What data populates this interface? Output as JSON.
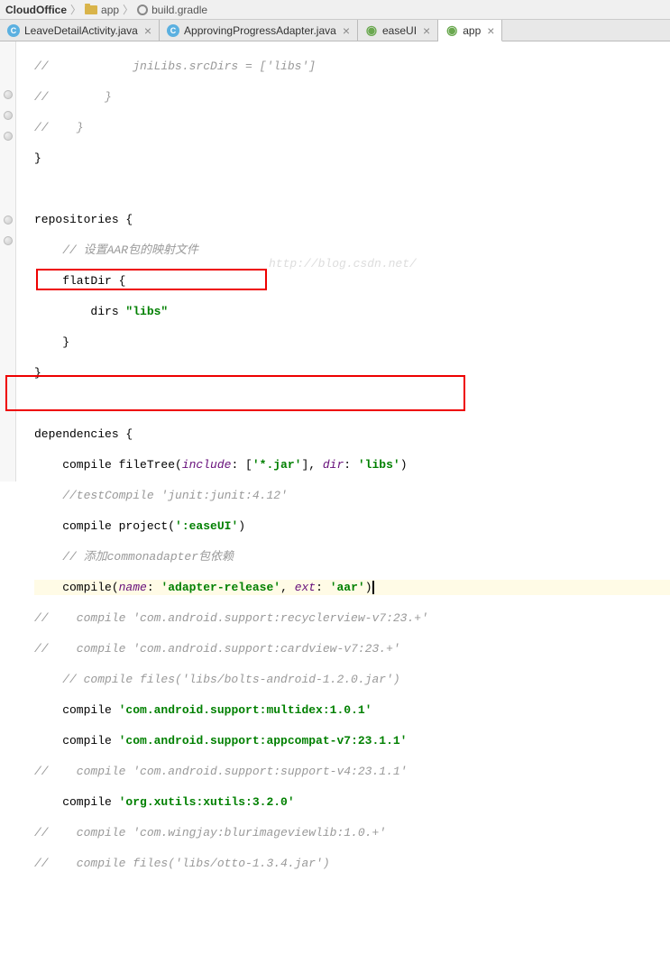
{
  "breadcrumb": {
    "part1": "CloudOffice",
    "part2": "app",
    "part3": "build.gradle"
  },
  "tabs": [
    {
      "label": "LeaveDetailActivity.java"
    },
    {
      "label": "ApprovingProgressAdapter.java"
    },
    {
      "label": "easeUI"
    },
    {
      "label": "app"
    }
  ],
  "code": {
    "l1_a": "//            jniLibs.srcDirs = ['libs']",
    "l2_a": "//        }",
    "l3_a": "//    }",
    "l4_a": "}",
    "l5_a": "",
    "l6_a": "repositories {",
    "l7_a": "    // 设置AAR包的映射文件",
    "l8_a": "    flatDir {",
    "l9_a": "        dirs ",
    "l9_b": "\"libs\"",
    "l10_a": "    }",
    "l11_a": "}",
    "l12_a": "",
    "l13_a": "dependencies {",
    "l14_a": "    compile fileTree(",
    "l14_b": "include",
    "l14_c": ": [",
    "l14_d": "'*.jar'",
    "l14_e": "], ",
    "l14_f": "dir",
    "l14_g": ": ",
    "l14_h": "'libs'",
    "l14_i": ")",
    "l15_a": "    //testCompile 'junit:junit:4.12'",
    "l16_a": "    compile project(",
    "l16_b": "':easeUI'",
    "l16_c": ")",
    "l17_a": "    // 添加commonadapter包依赖",
    "l18_a": "    compile(",
    "l18_b": "name",
    "l18_c": ": ",
    "l18_d": "'adapter-release'",
    "l18_e": ", ",
    "l18_f": "ext",
    "l18_g": ": ",
    "l18_h": "'aar'",
    "l18_i": ")",
    "l19_a": "//    compile 'com.android.support:recyclerview-v7:23.+'",
    "l20_a": "//    compile 'com.android.support:cardview-v7:23.+'",
    "l21_a": "    // compile files('libs/bolts-android-1.2.0.jar')",
    "l22_a": "    compile ",
    "l22_b": "'com.android.support:multidex:1.0.1'",
    "l23_a": "    compile ",
    "l23_b": "'com.android.support:appcompat-v7:23.1.1'",
    "l24_a": "//    compile 'com.android.support:support-v4:23.1.1'",
    "l25_a": "    compile ",
    "l25_b": "'org.xutils:xutils:3.2.0'",
    "l26_a": "//    compile 'com.wingjay:blurimageviewlib:1.0.+'",
    "l27_a": "//    compile files('libs/otto-1.3.4.jar')"
  },
  "watermark": "http://blog.csdn.net/"
}
